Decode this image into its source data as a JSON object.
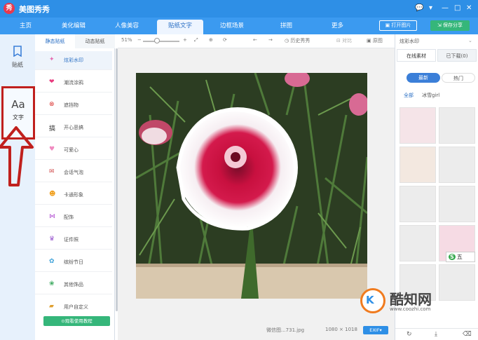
{
  "app": {
    "title": "美图秀秀",
    "logo_letter": "秀"
  },
  "window_controls": [
    "💬",
    "▾",
    "—",
    "□",
    "✕"
  ],
  "nav": {
    "tabs": [
      {
        "label": "主页"
      },
      {
        "label": "美化编辑"
      },
      {
        "label": "人像美容"
      },
      {
        "label": "贴纸文字",
        "active": true
      },
      {
        "label": "边框场景"
      },
      {
        "label": "拼图"
      },
      {
        "label": "更多"
      }
    ],
    "open_image": "打开图片",
    "save_share": "保存分享"
  },
  "left_nav": {
    "items": [
      {
        "label": "贴纸",
        "icon": "sticker-icon"
      },
      {
        "label": "文字",
        "icon": "text-aa-icon",
        "highlighted": true
      }
    ]
  },
  "sticker_panel": {
    "subtabs": [
      "静态贴纸",
      "动态贴纸"
    ],
    "categories": [
      {
        "label": "炫彩水印",
        "icon": "sparkle-icon",
        "selected": true
      },
      {
        "label": "潮流涂鸦",
        "icon": "heart-lips-icon"
      },
      {
        "label": "遮挡物",
        "icon": "block-icon"
      },
      {
        "label": "开心恶搞",
        "icon": "prank-icon"
      },
      {
        "label": "可爱心",
        "icon": "cute-heart-icon"
      },
      {
        "label": "会话气泡",
        "icon": "speech-bubble-icon"
      },
      {
        "label": "卡通形象",
        "icon": "cartoon-icon"
      },
      {
        "label": "配饰",
        "icon": "bow-icon"
      },
      {
        "label": "证件照",
        "icon": "id-photo-icon"
      },
      {
        "label": "缤纷节日",
        "icon": "festival-icon"
      },
      {
        "label": "其他饰品",
        "icon": "other-ornament-icon"
      },
      {
        "label": "用户自定义",
        "icon": "folder-icon"
      }
    ],
    "tutorial_button": "观看使用教程"
  },
  "toolbar": {
    "zoom": "51%",
    "history": "历史秀秀",
    "compare": "对比",
    "original": "原图"
  },
  "canvas": {
    "file_name": "微信图...731.jpg",
    "dimensions": "1080 × 1018",
    "exif": "EXIF"
  },
  "material_panel": {
    "title": "炫彩水印",
    "tabs": [
      "在线素材",
      "已下载(0)"
    ],
    "sort": [
      "最新",
      "热门"
    ],
    "filters": [
      "全部",
      "冰雪girl"
    ]
  },
  "watermark": {
    "brand": "酷知网",
    "url": "www.coozhi.com"
  },
  "ime": {
    "label": "五"
  },
  "colors": {
    "titlebar": "#2e8fe6",
    "accent_green": "#35b67a",
    "highlight_red": "#c0201d"
  }
}
